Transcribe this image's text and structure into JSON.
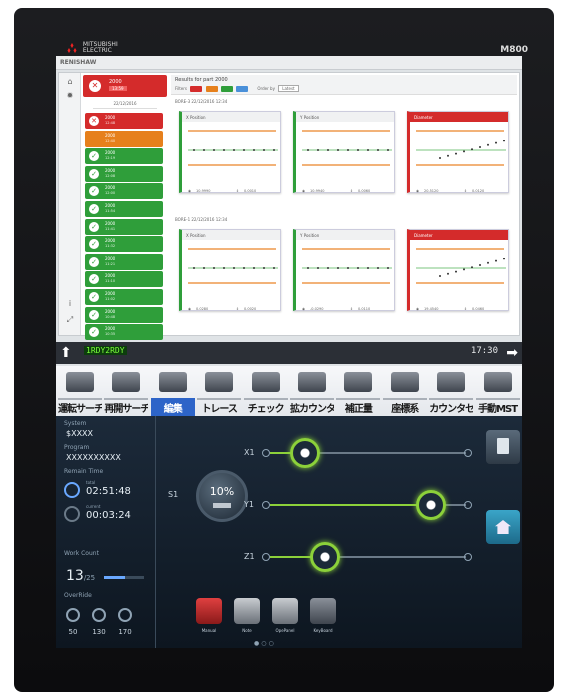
{
  "device": {
    "model": "M800",
    "brand_line1": "MITSUBISHI",
    "brand_line2": "ELECTRIC"
  },
  "app": {
    "title": "RENISHAW",
    "top_item": {
      "title": "2000",
      "sub": "13:59"
    },
    "list_date": "22/12/2016",
    "rows": [
      {
        "title": "2000",
        "sub": "12:48",
        "status": "red",
        "icon": "x-icon"
      },
      {
        "title": "2000",
        "sub": "12:40",
        "status": "orange",
        "icon": "warning-icon"
      },
      {
        "title": "2000",
        "sub": "12:19",
        "status": "green",
        "icon": "check-icon"
      },
      {
        "title": "2000",
        "sub": "12:08",
        "status": "green",
        "icon": "check-icon"
      },
      {
        "title": "2000",
        "sub": "12:00",
        "status": "green",
        "icon": "check-icon"
      },
      {
        "title": "2000",
        "sub": "11:54",
        "status": "green",
        "icon": "check-icon"
      },
      {
        "title": "2000",
        "sub": "11:41",
        "status": "green",
        "icon": "check-icon"
      },
      {
        "title": "2000",
        "sub": "11:32",
        "status": "green",
        "icon": "check-icon"
      },
      {
        "title": "2000",
        "sub": "11:21",
        "status": "green",
        "icon": "check-icon"
      },
      {
        "title": "2000",
        "sub": "11:10",
        "status": "green",
        "icon": "check-icon"
      },
      {
        "title": "2000",
        "sub": "11:02",
        "status": "green",
        "icon": "check-icon"
      },
      {
        "title": "2000",
        "sub": "10:48",
        "status": "green",
        "icon": "check-icon"
      },
      {
        "title": "2000",
        "sub": "10:35",
        "status": "green",
        "icon": "check-icon"
      }
    ],
    "results_title": "Results for part 2000",
    "filters_label": "Filters",
    "order_label": "Order by",
    "order_value": "Latest",
    "groups": [
      {
        "label": "BORE-3   22/12/2016   12:34",
        "cards": [
          {
            "name": "X Position",
            "status": "ok",
            "v1": "10.9990",
            "v2": "0.0010"
          },
          {
            "name": "Y Position",
            "status": "ok",
            "v1": "10.9940",
            "v2": "0.0060"
          },
          {
            "name": "Diameter",
            "status": "bad",
            "v1": "20.5120",
            "v2": "0.0120"
          }
        ]
      },
      {
        "label": "BORE-1   22/12/2016   12:34",
        "cards": [
          {
            "name": "X Position",
            "status": "ok",
            "v1": "0.0280",
            "v2": "0.0020"
          },
          {
            "name": "Y Position",
            "status": "ok",
            "v1": "-0.0290",
            "v2": "0.0110"
          },
          {
            "name": "Diameter",
            "status": "bad",
            "v1": "19.4540",
            "v2": "0.0460"
          }
        ]
      }
    ]
  },
  "status": {
    "text": "1RDY2RDY",
    "clock": "17:30"
  },
  "menu": [
    {
      "label": "運転サーチ"
    },
    {
      "label": "再開サーチ"
    },
    {
      "label": "編集"
    },
    {
      "label": "トレース"
    },
    {
      "label": "チェック"
    },
    {
      "label": "拡カウンタ"
    },
    {
      "label": "補正量"
    },
    {
      "label": "座標系"
    },
    {
      "label": "カウンタセット"
    },
    {
      "label": "手動MST"
    }
  ],
  "info": {
    "system_label": "System",
    "system": "$XXXX",
    "program_label": "Program",
    "program": "XXXXXXXXXX",
    "remain_label": "Remain Time",
    "total_label": "total",
    "total": "02:51:48",
    "current_label": "current",
    "current": "00:03:24",
    "work_label": "Work Count",
    "work_count": "13",
    "work_total": "/25",
    "work_progress": 0.52,
    "override_label": "OverRide",
    "overrides": [
      "50",
      "130",
      "170"
    ]
  },
  "spindle": {
    "label": "S1",
    "percent": "10%"
  },
  "axes": [
    {
      "label": "X1",
      "level": 0.18
    },
    {
      "label": "Y1",
      "level": 0.82
    },
    {
      "label": "Z1",
      "level": 0.28
    }
  ],
  "dock": [
    {
      "label": "Manual"
    },
    {
      "label": "Note"
    },
    {
      "label": "OpePanel"
    },
    {
      "label": "KeyBoard"
    }
  ],
  "colors": {
    "ok": "#2f9e3a",
    "ng": "#d42b2b",
    "warn": "#e6801c",
    "accent": "#2d64c8",
    "axis": "#8cd13a"
  }
}
